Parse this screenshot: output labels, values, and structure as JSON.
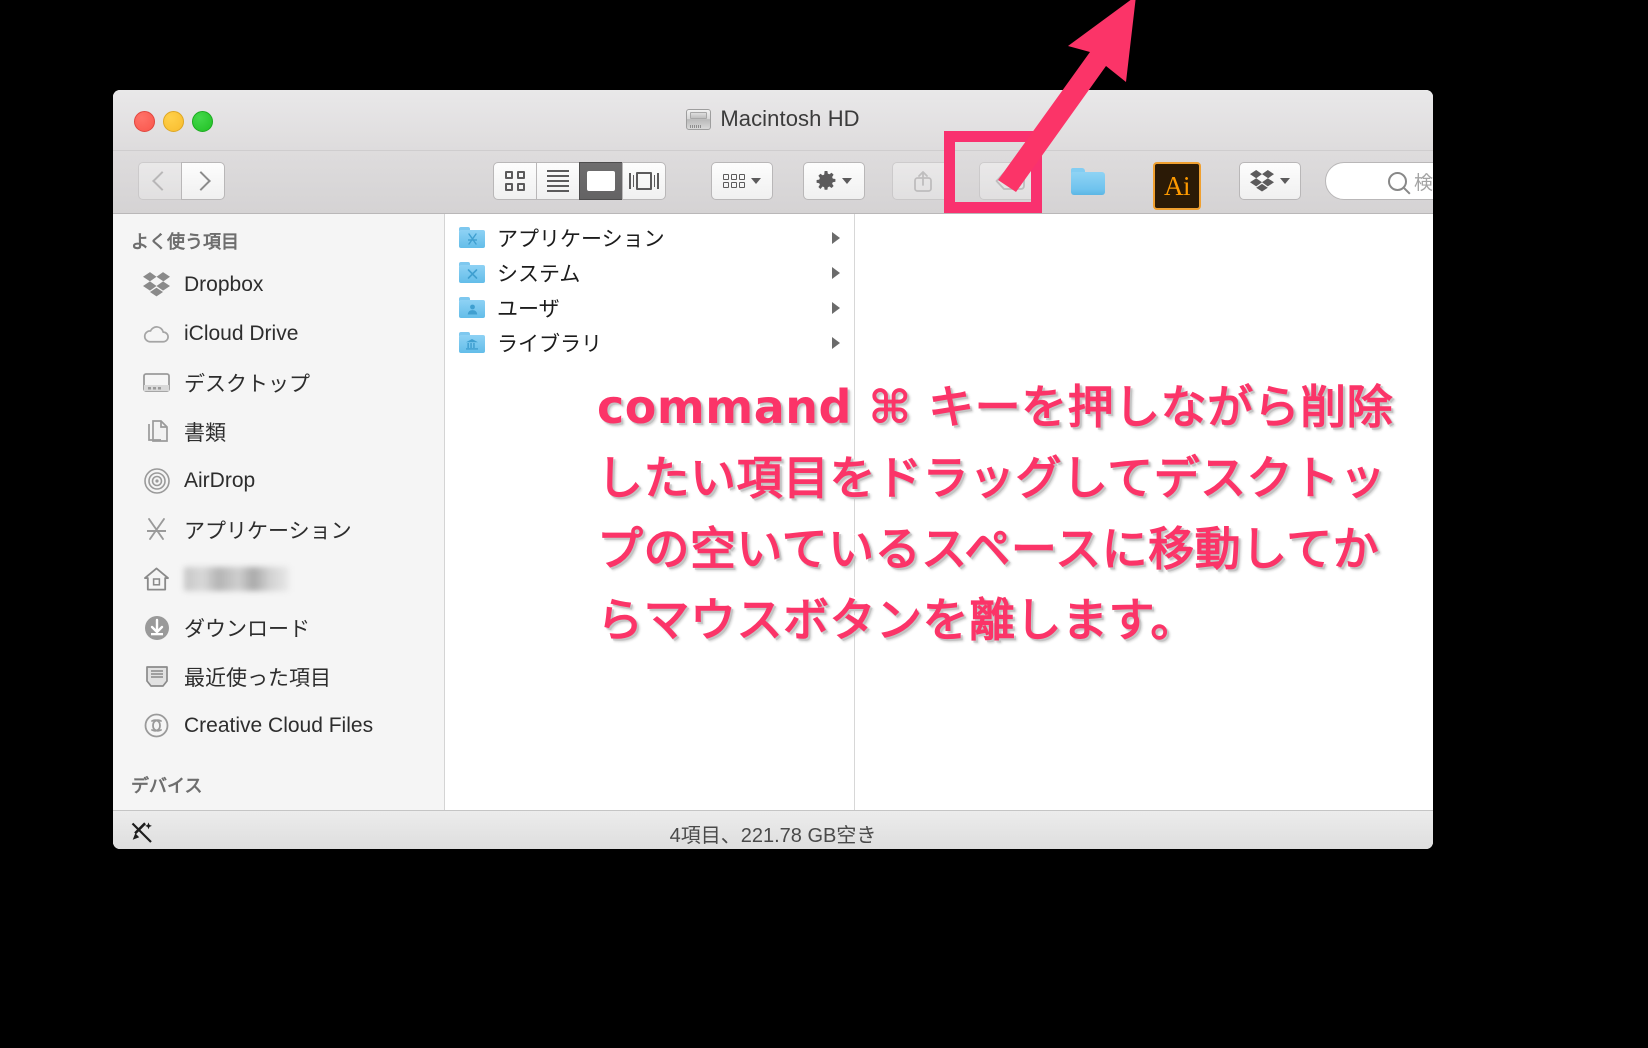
{
  "window": {
    "title": "Macintosh HD",
    "title_icon": "hard-disk-icon",
    "traffic_lights": [
      "close-red",
      "minimize-yellow",
      "zoom-green"
    ]
  },
  "toolbar": {
    "back_label": "◀",
    "forward_label": "▶",
    "view_modes": [
      {
        "name": "icon-view",
        "label": "icon",
        "active": false
      },
      {
        "name": "list-view",
        "label": "list",
        "active": false
      },
      {
        "name": "column-view",
        "label": "column",
        "active": true
      },
      {
        "name": "coverflow-view",
        "label": "coverflow",
        "active": false
      }
    ],
    "arrange_label": "arrange",
    "action_label": "action",
    "share_label": "share",
    "tag_label": "tag",
    "folder_label": "new-folder",
    "ai_label": "Ai",
    "dropbox_label": "dropbox"
  },
  "search": {
    "placeholder": "検索",
    "value": ""
  },
  "sidebar": {
    "sections": [
      {
        "header": "よく使う項目",
        "items": [
          {
            "label": "Dropbox",
            "icon": "dropbox-icon",
            "blurred": false
          },
          {
            "label": "iCloud Drive",
            "icon": "cloud-icon",
            "blurred": false
          },
          {
            "label": "デスクトップ",
            "icon": "desktop-icon",
            "blurred": false
          },
          {
            "label": "書類",
            "icon": "documents-icon",
            "blurred": false
          },
          {
            "label": "AirDrop",
            "icon": "airdrop-icon",
            "blurred": false
          },
          {
            "label": "アプリケーション",
            "icon": "applications-icon",
            "blurred": false
          },
          {
            "label": "",
            "icon": "home-icon",
            "blurred": true
          },
          {
            "label": "ダウンロード",
            "icon": "downloads-icon",
            "blurred": false
          },
          {
            "label": "最近使った項目",
            "icon": "recents-icon",
            "blurred": false
          },
          {
            "label": "Creative Cloud Files",
            "icon": "creative-cloud-icon",
            "blurred": false
          }
        ]
      },
      {
        "header": "デバイス",
        "items": []
      }
    ]
  },
  "columns": [
    {
      "items": [
        {
          "label": "アプリケーション",
          "icon": "applications-folder-icon",
          "has_children": true
        },
        {
          "label": "システム",
          "icon": "system-folder-icon",
          "has_children": true
        },
        {
          "label": "ユーザ",
          "icon": "users-folder-icon",
          "has_children": true
        },
        {
          "label": "ライブラリ",
          "icon": "library-folder-icon",
          "has_children": true
        }
      ]
    }
  ],
  "statusbar": {
    "text": "4項目、221.78 GB空き",
    "left_icon": "dropbox-badge-off-icon"
  },
  "annotation": {
    "callout_text": "command ⌘ キーを押しながら削除したい項目をドラッグしてデスクトップの空いているスペースに移動してからマウスボタンを離します。",
    "accent_color": "#fb3468",
    "highlight_target": "new-folder-toolbar-button",
    "arrow": "arrow-up-right"
  }
}
